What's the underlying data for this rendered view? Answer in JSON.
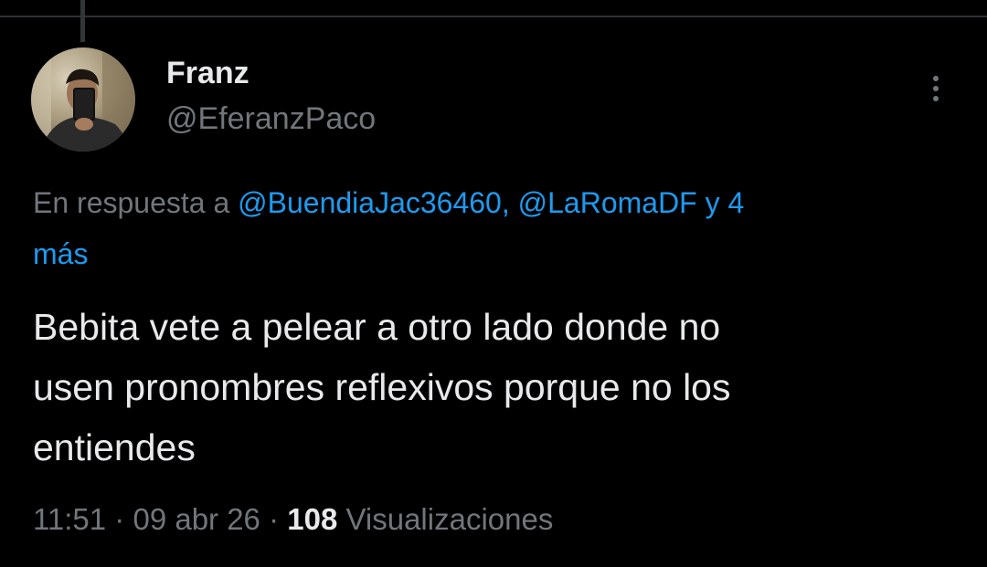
{
  "tweet": {
    "author": {
      "display_name": "Franz",
      "handle": "@EferanzPaco"
    },
    "reply_context": {
      "prefix": "En respuesta a ",
      "mention_1": "@BuendiaJac36460",
      "separator": ", ",
      "mention_2": "@LaRomaDF",
      "others_line1": " y 4",
      "others_line2": "más"
    },
    "text_lines": [
      "Bebita vete a pelear a otro lado donde no",
      "usen pronombres reflexivos porque no los",
      "entiendes"
    ],
    "meta": {
      "time": "11:51",
      "sep1": " · ",
      "date": "09 abr 26",
      "sep2": " · ",
      "views_count": "108",
      "views_label": " Visualizaciones"
    }
  },
  "icons": {
    "more": "more-vertical-icon"
  },
  "colors": {
    "background": "#000000",
    "primary_text": "#e7e9ea",
    "secondary_text": "#71767b",
    "link": "#1d9bf0",
    "divider": "#2f3336"
  }
}
